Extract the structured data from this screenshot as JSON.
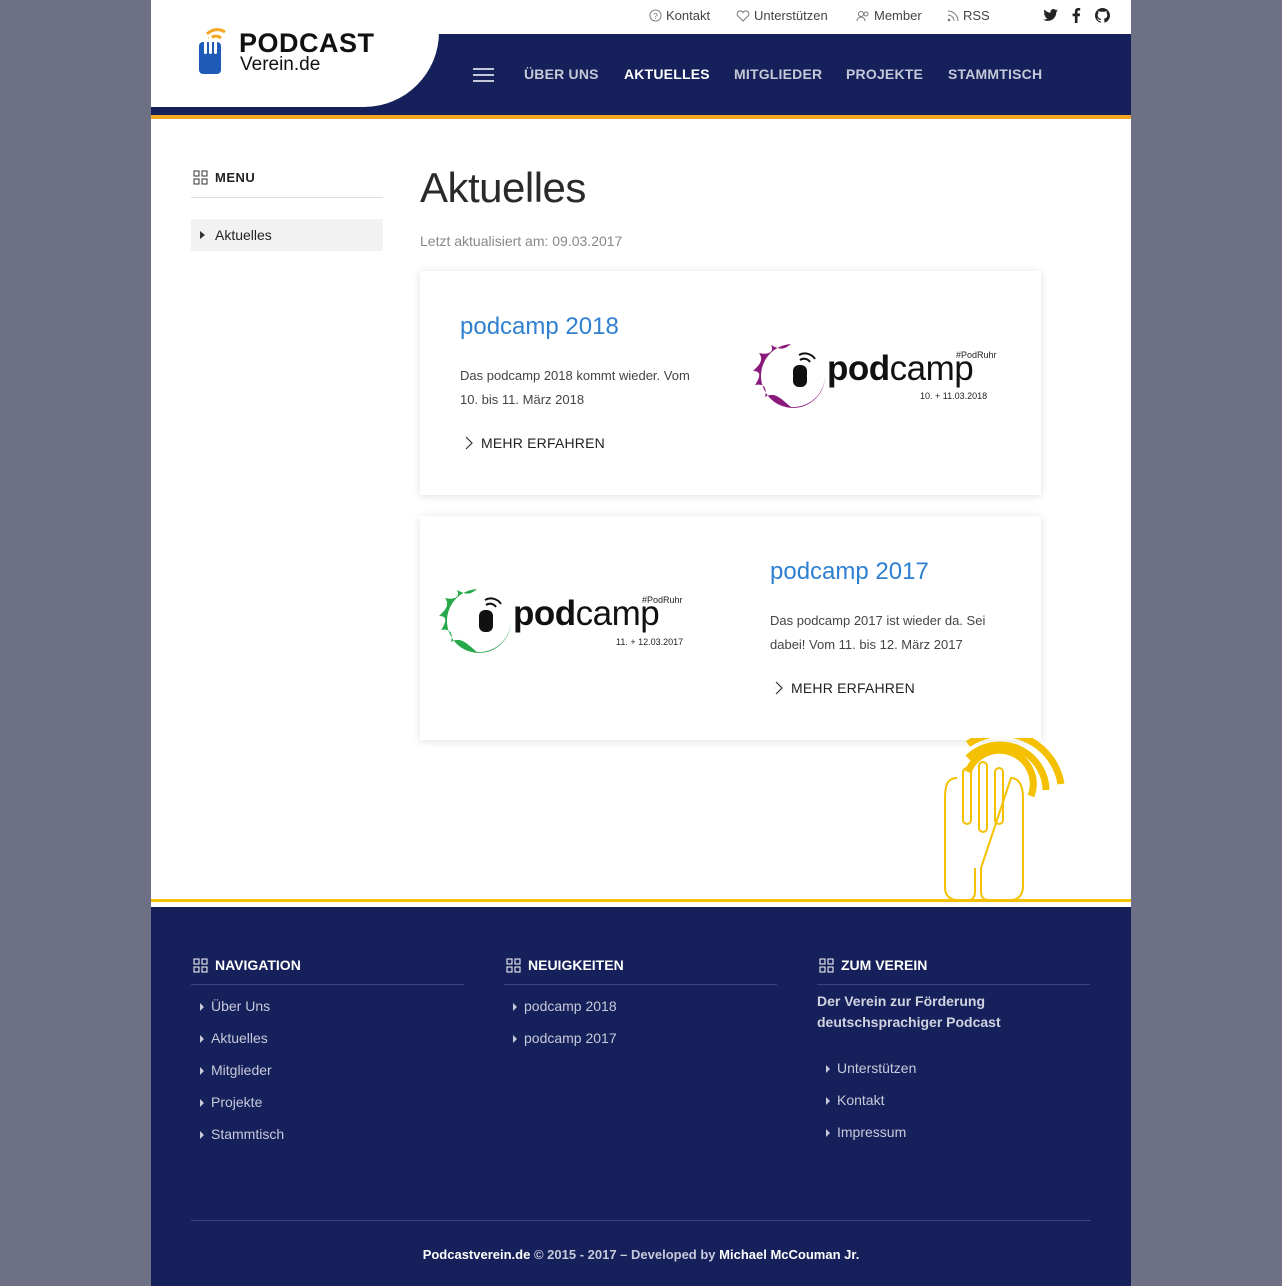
{
  "header": {
    "logo_line1": "PODCAST",
    "logo_line2": "Verein.de",
    "top_links": [
      "Kontakt",
      "Unterstützen",
      "Member",
      "RSS"
    ],
    "nav": [
      "ÜBER UNS",
      "AKTUELLES",
      "MITGLIEDER",
      "PROJEKTE",
      "STAMMTISCH"
    ],
    "active_nav": "AKTUELLES"
  },
  "sidebar": {
    "heading": "MENU",
    "items": [
      "Aktuelles"
    ]
  },
  "main": {
    "title": "Aktuelles",
    "updated": "Letzt aktualisiert am: 09.03.2017",
    "cards": [
      {
        "title": "podcamp 2018",
        "text": "Das podcamp 2018 kommt wieder. Vom 10. bis 11. März 2018",
        "link": "MEHR ERFAHREN",
        "logo_word1": "pod",
        "logo_word2": "camp",
        "logo_tag": "#PodRuhr",
        "logo_date": "10. + 11.03.2018",
        "logo_color": "#8b1a7d"
      },
      {
        "title": "podcamp 2017",
        "text": "Das podcamp 2017 ist wieder da. Sei dabei! Vom 11. bis 12. März 2017",
        "link": "MEHR ERFAHREN",
        "logo_word1": "pod",
        "logo_word2": "camp",
        "logo_tag": "#PodRuhr",
        "logo_date": "11. + 12.03.2017",
        "logo_color": "#27a84a"
      }
    ]
  },
  "footer": {
    "navigation": {
      "heading": "NAVIGATION",
      "links": [
        "Über Uns",
        "Aktuelles",
        "Mitglieder",
        "Projekte",
        "Stammtisch"
      ]
    },
    "news": {
      "heading": "NEUIGKEITEN",
      "links": [
        "podcamp 2018",
        "podcamp 2017"
      ]
    },
    "verein": {
      "heading": "ZUM VEREIN",
      "text": "Der Verein zur Förderung deutschsprachiger Podcast",
      "links": [
        "Unterstützen",
        "Kontakt",
        "Impressum"
      ]
    },
    "copyright_site": "Podcastverein.de",
    "copyright_years": "© 2015 - 2017 – Developed by",
    "copyright_author": "Michael McCouman Jr."
  },
  "colors": {
    "navy": "#16205a",
    "orange": "#f5a623",
    "yellow": "#f5c000",
    "link_blue": "#2f80d1"
  },
  "icons": [
    "help-circle-icon",
    "heart-icon",
    "users-icon",
    "rss-icon",
    "twitter-icon",
    "facebook-icon",
    "github-icon",
    "hamburger-icon",
    "grid-icon",
    "chevron-right-icon"
  ]
}
